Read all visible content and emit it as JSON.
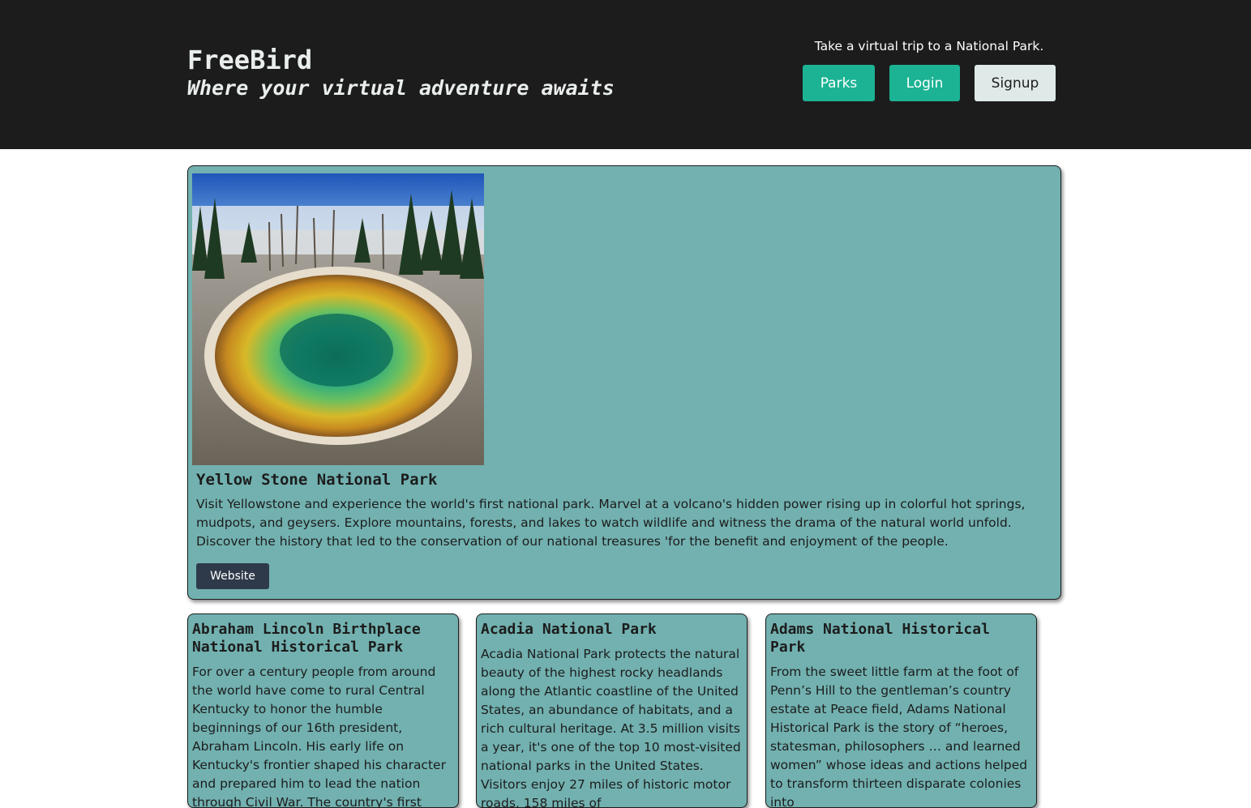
{
  "header": {
    "title": "FreeBird",
    "tagline": "Where your virtual adventure awaits",
    "note": "Take a virtual trip to a National Park.",
    "nav": {
      "parks": "Parks",
      "login": "Login",
      "signup": "Signup"
    }
  },
  "featured": {
    "title": "Yellow Stone National Park",
    "description": "Visit Yellowstone and experience the world's first national park. Marvel at a volcano's hidden power rising up in colorful hot springs, mudpots, and geysers. Explore mountains, forests, and lakes to watch wildlife and witness the drama of the natural world unfold. Discover the history that led to the conservation of our national treasures 'for the benefit and enjoyment of the people.",
    "website_label": "Website"
  },
  "cards": [
    {
      "title": "Abraham Lincoln Birthplace National Historical Park",
      "description": "For over a century people from around the world have come to rural Central Kentucky to honor the humble beginnings of our 16th president, Abraham Lincoln. His early life on Kentucky's frontier shaped his character and prepared him to lead the nation through Civil War. The country's first"
    },
    {
      "title": "Acadia National Park",
      "description": "Acadia National Park protects the natural beauty of the highest rocky headlands along the Atlantic coastline of the United States, an abundance of habitats, and a rich cultural heritage. At 3.5 million visits a year, it's one of the top 10 most-visited national parks in the United States. Visitors enjoy 27 miles of historic motor roads, 158 miles of"
    },
    {
      "title": "Adams National Historical Park",
      "description": "From the sweet little farm at the foot of Penn’s Hill to the gentleman’s country estate at Peace field, Adams National Historical Park is the story of “heroes, statesman, philosophers … and learned women” whose ideas and actions helped to transform thirteen disparate colonies into"
    }
  ]
}
